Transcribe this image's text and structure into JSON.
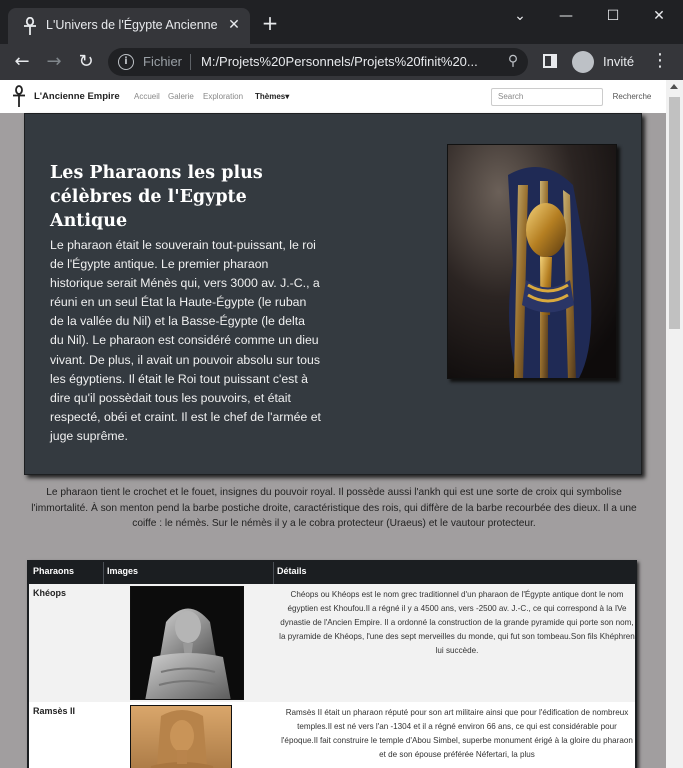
{
  "browser": {
    "tab_title": "L'Univers de l'Égypte Ancienne",
    "tab_close": "✕",
    "new_tab": "+",
    "window_controls": {
      "minimize": "⌄",
      "restore": "—",
      "maximize": "☐",
      "close": "✕"
    },
    "address_scheme": "Fichier",
    "address_url": "M:/Projets%20Personnels/Projets%20finit%20...",
    "profile_label": "Invité",
    "icons": [
      "ankh-icon",
      "back-icon",
      "forward-icon",
      "reload-icon",
      "info-icon",
      "zoom-icon",
      "side-panel-icon",
      "profile-icon",
      "menu-icon"
    ]
  },
  "site_nav": {
    "brand": "L'Ancienne Empire",
    "links": [
      "Accueil",
      "Galerie",
      "Exploration",
      "Thèmes▾"
    ],
    "search_placeholder": "Search",
    "search_button": "Recherche"
  },
  "hero": {
    "title": "Les Pharaons les plus célèbres de l'Egypte Antique",
    "text": "Le pharaon était le souverain tout-puissant, le roi de l'Égypte antique. Le premier pharaon historique serait Ménès qui, vers 3000 av. J.-C., a réuni en un seul État la Haute-Égypte (le ruban de la vallée du Nil) et la Basse-Égypte (le delta du Nil). Le pharaon est considéré comme un dieu vivant. De plus, il avait un pouvoir absolu sur tous les égyptiens. Il était le Roi tout puissant c'est à dire qu'il possèdait tous les pouvoirs, et était respecté, obéi et craint. Il est le chef de l'armée et juge suprême."
  },
  "intro": "Le pharaon tient le crochet et le fouet, insignes du pouvoir royal. Il possède aussi l'ankh qui est une sorte de croix qui symbolise l'immortalité. À son menton pend la barbe postiche droite, caractéristique des rois, qui diffère de la barbe recourbée des dieux. Il a une coiffe : le némès. Sur le némès il y a le cobra protecteur (Uraeus) et le vautour protecteur.",
  "table": {
    "headers": [
      "Pharaons",
      "Images",
      "Détails"
    ],
    "rows": [
      {
        "name": "Khéops",
        "details": "Chéops ou Khéops est le nom grec traditionnel d'un pharaon de l'Égypte antique dont le nom égyptien est Khoufou.Il a régné il y a 4500 ans, vers -2500 av. J.-C., ce qui correspond à la IVe dynastie de l'Ancien Empire. Il a ordonné la construction de la grande pyramide qui porte son nom, la pyramide de Khéops, l'une des sept merveilles du monde, qui fut son tombeau.Son fils Khéphren lui succède."
      },
      {
        "name": "Ramsès II",
        "details": "Ramsès II était un pharaon réputé pour son art militaire ainsi que pour l'édification de nombreux temples.Il est né vers l'an -1304 et il a régné environ 66 ans, ce qui est considérable pour l'époque.Il fait construire le temple d'Abou Simbel, superbe monument érigé à la gloire du pharaon et de son épouse préférée Néfertari, la plus"
      }
    ]
  },
  "colors": {
    "chrome_dark": "#202124",
    "chrome_tab": "#35363a",
    "hero_bg": "#343a40",
    "page_bg": "#a19e9f",
    "table_header": "#1b1e21"
  }
}
